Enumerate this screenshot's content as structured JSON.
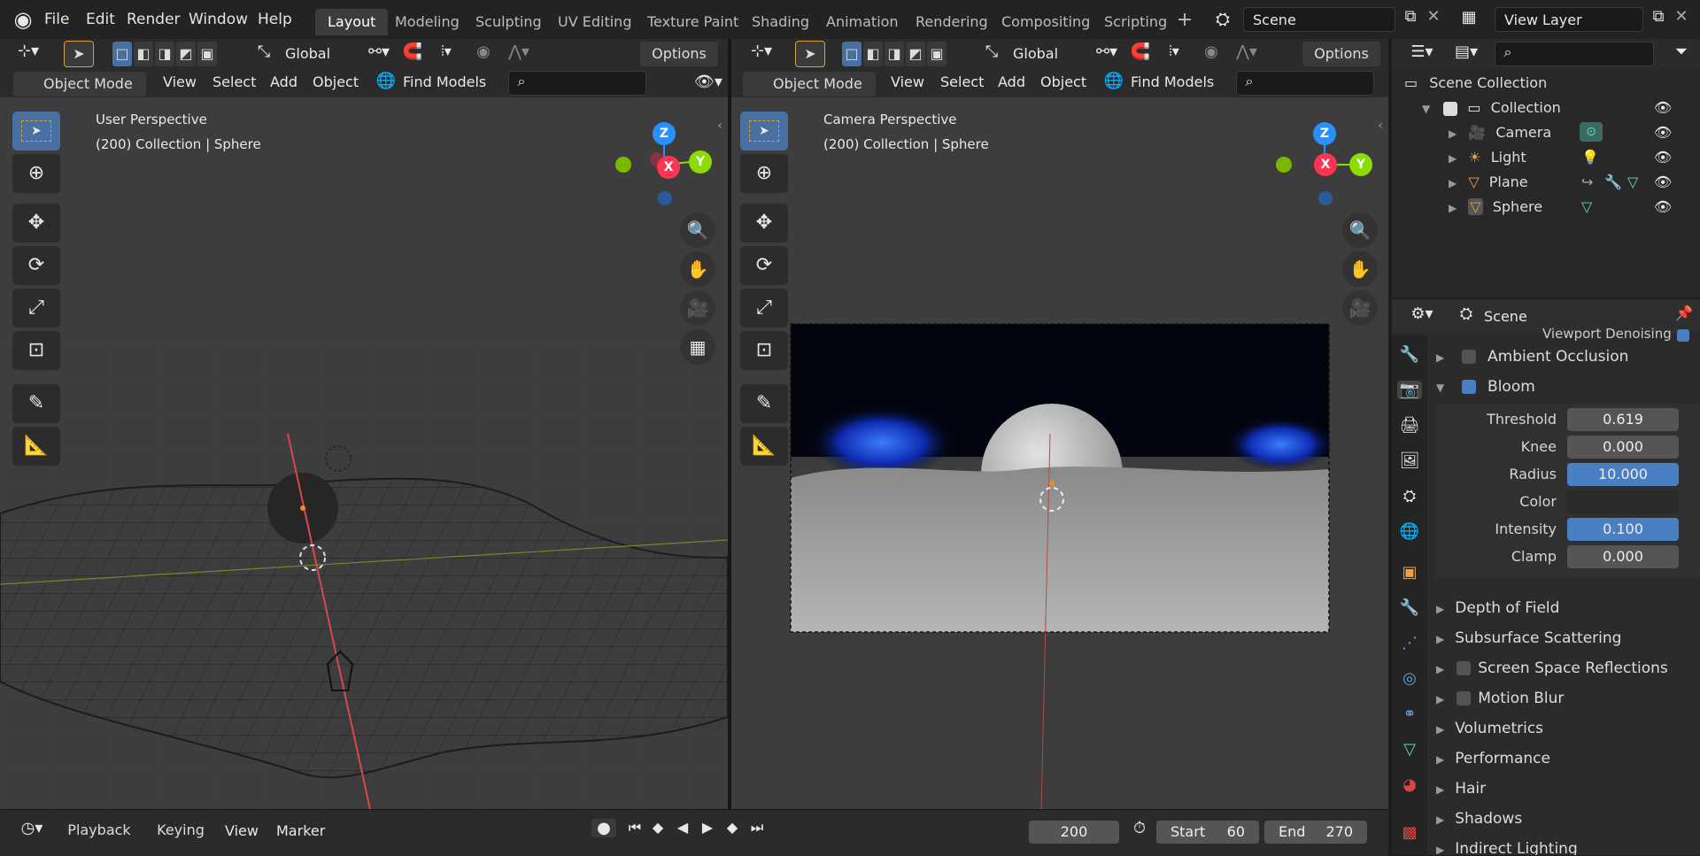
{
  "topbar": {
    "menus": [
      "File",
      "Edit",
      "Render",
      "Window",
      "Help"
    ],
    "workspaces": [
      "Layout",
      "Modeling",
      "Sculpting",
      "UV Editing",
      "Texture Paint",
      "Shading",
      "Animation",
      "Rendering",
      "Compositing",
      "Scripting"
    ],
    "active_workspace": "Layout",
    "scene_name": "Scene",
    "view_layer": "View Layer"
  },
  "viewport_left": {
    "transform": "Global",
    "options": "Options",
    "mode": "Object Mode",
    "menus": [
      "View",
      "Select",
      "Add",
      "Object"
    ],
    "find_models": "Find Models",
    "overlay_line1": "User Perspective",
    "overlay_line2": "(200) Collection | Sphere",
    "gizmo": {
      "z": "Z",
      "y": "Y",
      "x": "X"
    }
  },
  "viewport_right": {
    "transform": "Global",
    "options": "Options",
    "mode": "Object Mode",
    "menus": [
      "View",
      "Select",
      "Add",
      "Object"
    ],
    "find_models": "Find Models",
    "overlay_line1": "Camera Perspective",
    "overlay_line2": "(200) Collection | Sphere",
    "gizmo": {
      "z": "Z",
      "y": "Y",
      "x": "X"
    }
  },
  "outliner": {
    "root": "Scene Collection",
    "collection": "Collection",
    "items": [
      "Camera",
      "Light",
      "Plane",
      "Sphere"
    ]
  },
  "properties": {
    "context": "Scene",
    "cut_label": "Viewport Denoising",
    "ambient_occlusion": "Ambient Occlusion",
    "bloom": "Bloom",
    "fields": [
      {
        "label": "Threshold",
        "value": "0.619"
      },
      {
        "label": "Knee",
        "value": "0.000"
      },
      {
        "label": "Radius",
        "value": "10.000"
      },
      {
        "label": "Color",
        "value": ""
      },
      {
        "label": "Intensity",
        "value": "0.100"
      },
      {
        "label": "Clamp",
        "value": "0.000"
      }
    ],
    "panels": [
      "Depth of Field",
      "Subsurface Scattering",
      "Screen Space Reflections",
      "Motion Blur",
      "Volumetrics",
      "Performance",
      "Hair",
      "Shadows",
      "Indirect Lighting"
    ]
  },
  "timeline": {
    "playback": "Playback",
    "keying": "Keying",
    "view": "View",
    "marker": "Marker",
    "current_frame": "200",
    "start_label": "Start",
    "start": "60",
    "end_label": "End",
    "end": "270"
  },
  "colors": {
    "accent": "#4a7fc1",
    "axis_x": "#ff3352",
    "axis_y": "#8bdc00",
    "axis_z": "#2890ff"
  }
}
